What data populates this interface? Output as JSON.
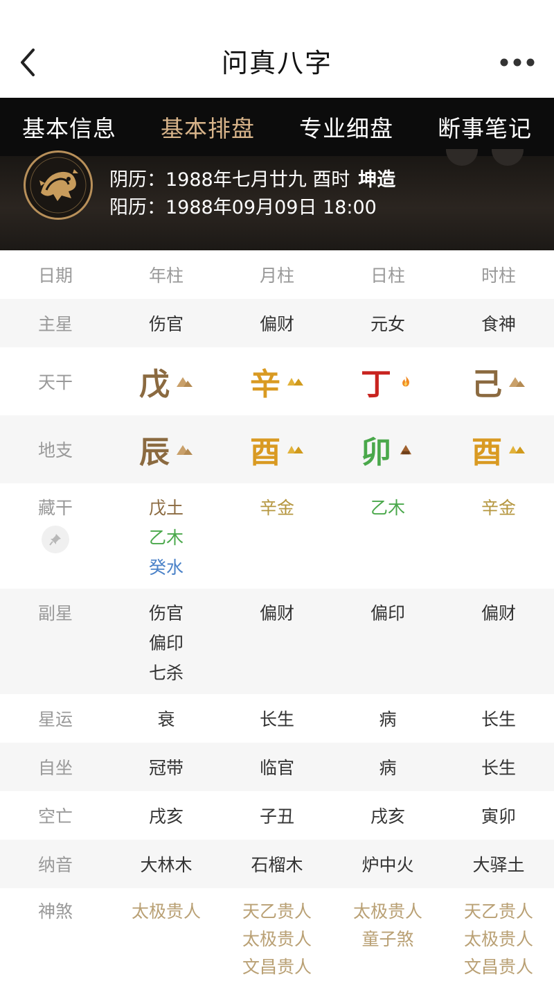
{
  "app": {
    "title": "问真八字"
  },
  "tabs": [
    {
      "label": "基本信息",
      "active": false
    },
    {
      "label": "基本排盘",
      "active": true
    },
    {
      "label": "专业细盘",
      "active": false
    },
    {
      "label": "断事笔记",
      "active": false
    }
  ],
  "profile": {
    "lunar_label": "阴历：",
    "lunar_value": "1988年七月廿九 酉时",
    "gender": "坤造",
    "solar_label": "阳历：",
    "solar_value": "1988年09月09日 18:00"
  },
  "table": {
    "header": [
      "日期",
      "年柱",
      "月柱",
      "日柱",
      "时柱"
    ],
    "zhuxing": {
      "label": "主星",
      "values": [
        "伤官",
        "偏财",
        "元女",
        "食神"
      ]
    },
    "tiangan": {
      "label": "天干",
      "values": [
        {
          "char": "戊",
          "color": "#8b6a40",
          "icon": "earth-icon"
        },
        {
          "char": "辛",
          "color": "#d99a22",
          "icon": "metal-icon"
        },
        {
          "char": "丁",
          "color": "#c8231f",
          "icon": "fire-icon"
        },
        {
          "char": "己",
          "color": "#8b6a40",
          "icon": "earth-icon"
        }
      ]
    },
    "dizhi": {
      "label": "地支",
      "values": [
        {
          "char": "辰",
          "color": "#8b6a40",
          "icon": "earth-icon"
        },
        {
          "char": "酉",
          "color": "#d99a22",
          "icon": "metal-icon"
        },
        {
          "char": "卯",
          "color": "#4aa84b",
          "icon": "wood-icon"
        },
        {
          "char": "酉",
          "color": "#d99a22",
          "icon": "metal-icon"
        }
      ]
    },
    "canggan": {
      "label": "藏干",
      "values": [
        [
          "戊土",
          "乙木",
          "癸水"
        ],
        [
          "辛金"
        ],
        [
          "乙木"
        ],
        [
          "辛金"
        ]
      ]
    },
    "fuxing": {
      "label": "副星",
      "values": [
        [
          "伤官",
          "偏印",
          "七杀"
        ],
        [
          "偏财"
        ],
        [
          "偏印"
        ],
        [
          "偏财"
        ]
      ]
    },
    "xingyun": {
      "label": "星运",
      "values": [
        "衰",
        "长生",
        "病",
        "长生"
      ]
    },
    "zizuo": {
      "label": "自坐",
      "values": [
        "冠带",
        "临官",
        "病",
        "长生"
      ]
    },
    "kongwang": {
      "label": "空亡",
      "values": [
        "戌亥",
        "子丑",
        "戌亥",
        "寅卯"
      ]
    },
    "nayin": {
      "label": "纳音",
      "values": [
        "大林木",
        "石榴木",
        "炉中火",
        "大驿土"
      ]
    },
    "shensha": {
      "label": "神煞",
      "values": [
        [
          "太极贵人"
        ],
        [
          "天乙贵人",
          "太极贵人",
          "文昌贵人"
        ],
        [
          "太极贵人",
          "童子煞"
        ],
        [
          "天乙贵人",
          "太极贵人",
          "文昌贵人"
        ]
      ]
    }
  },
  "colors": {
    "tab_active": "#d8b48a",
    "earth": "#8b6a40",
    "metal": "#d99a22",
    "fire": "#c8231f",
    "wood": "#4aa84b",
    "water": "#4b82c8"
  }
}
